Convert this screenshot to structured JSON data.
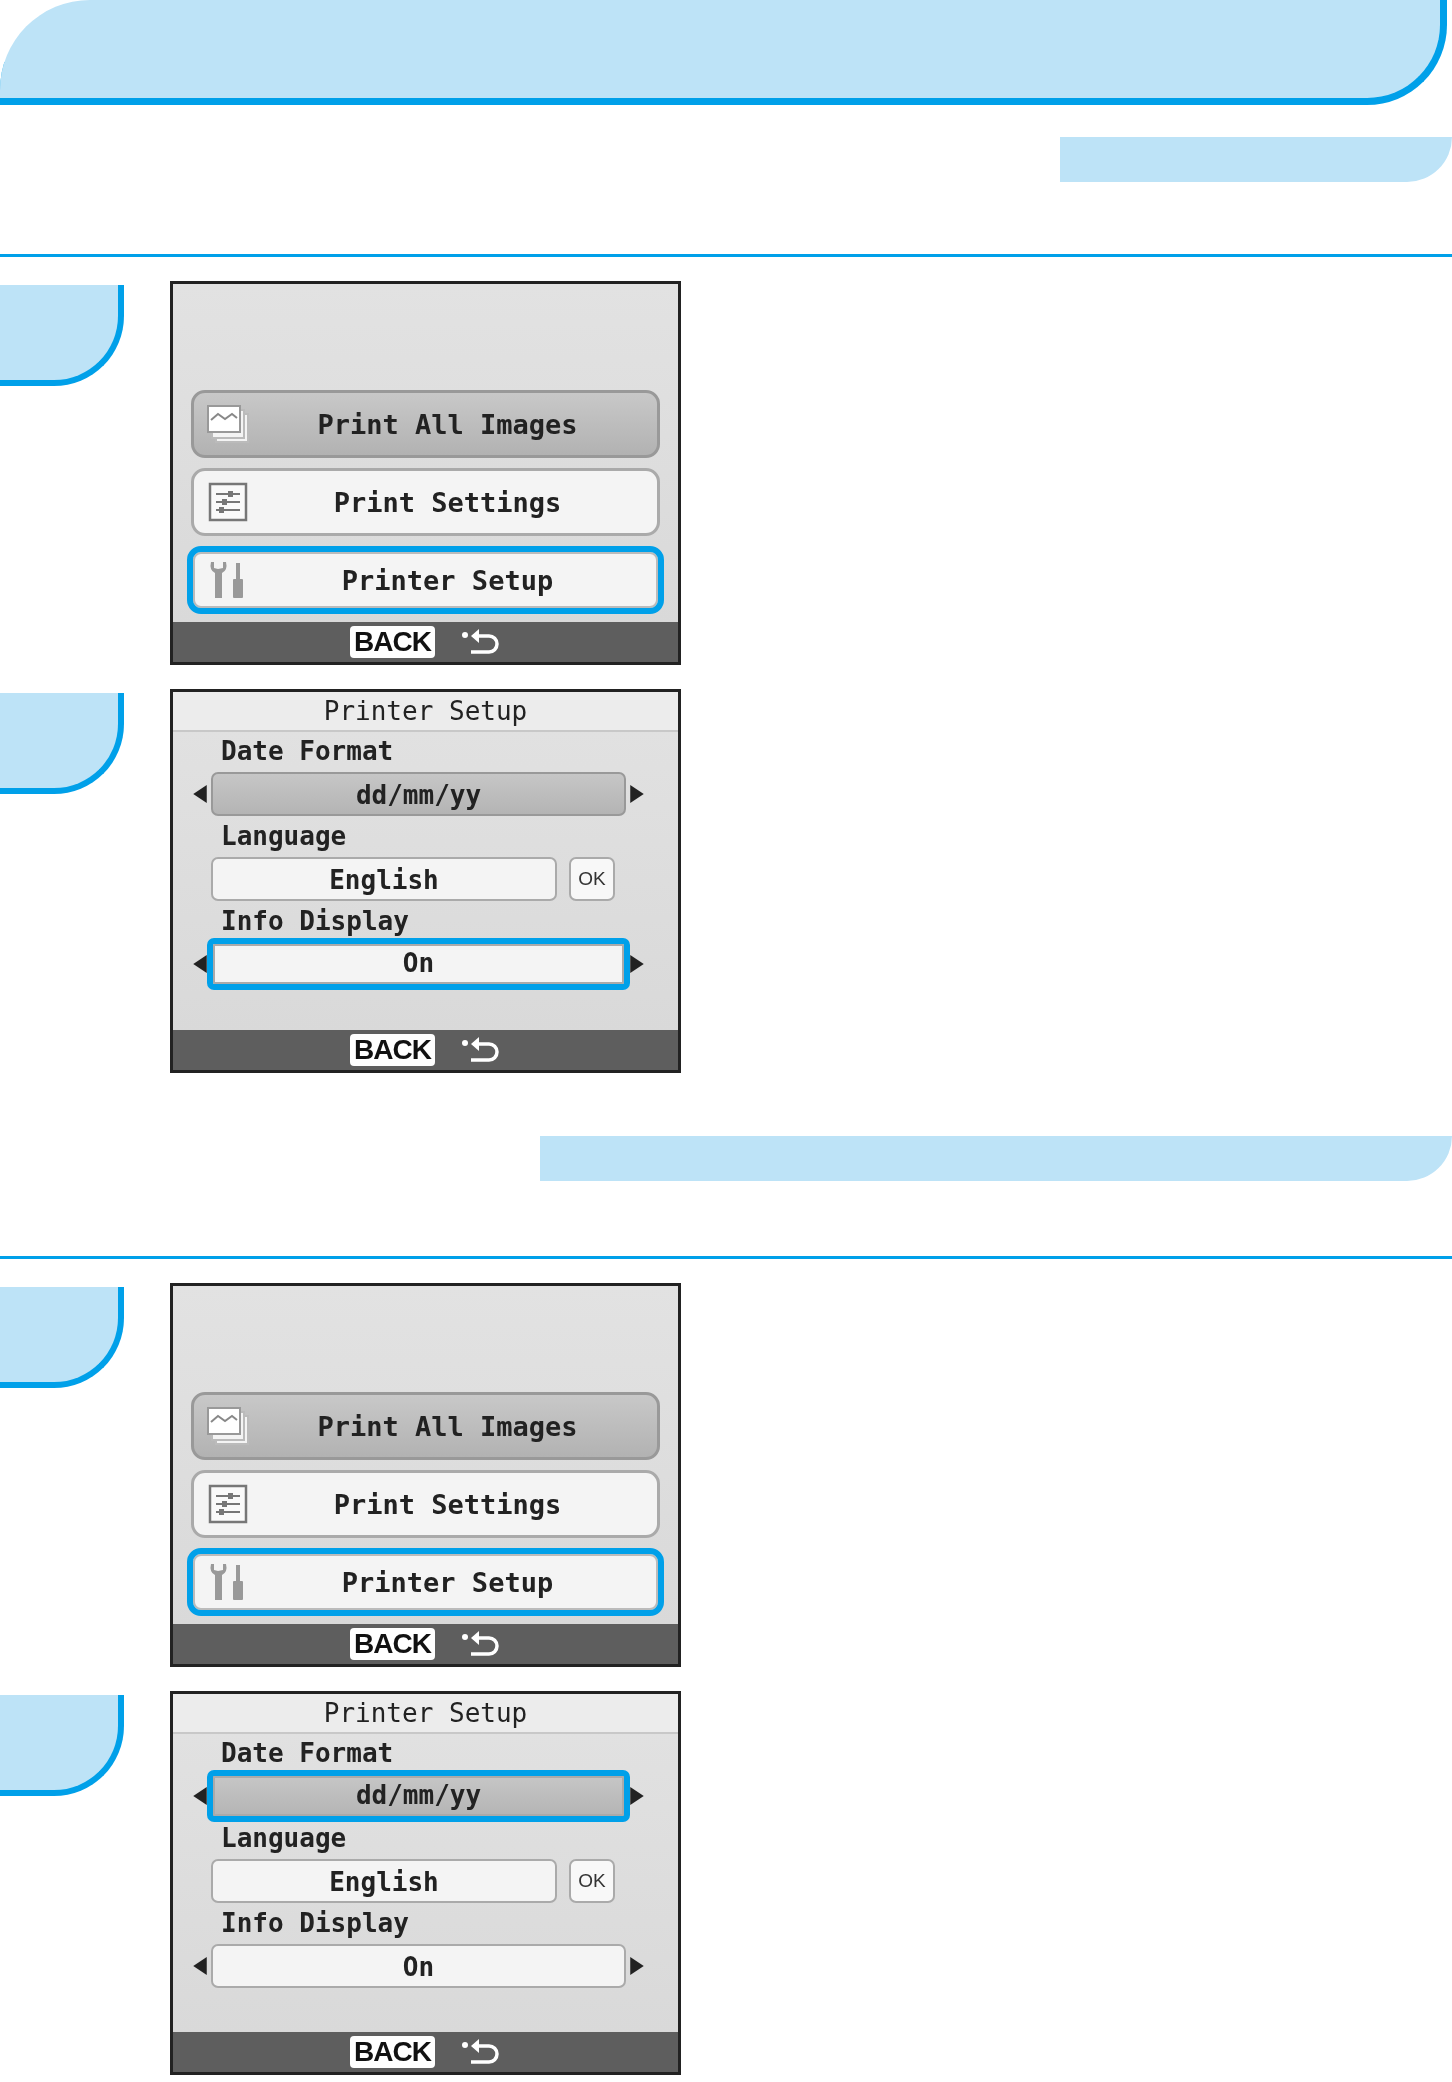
{
  "sections": [
    {
      "steps": [
        {
          "screen": {
            "kind": "menu",
            "items": [
              {
                "label": "Print All Images",
                "shaded": true,
                "selected": false
              },
              {
                "label": "Print Settings",
                "shaded": false,
                "selected": false
              },
              {
                "label": "Printer Setup",
                "shaded": false,
                "selected": true
              }
            ],
            "back": "BACK"
          }
        },
        {
          "screen": {
            "kind": "setup",
            "title": "Printer Setup",
            "rows": [
              {
                "kind": "cycle",
                "label": "Date Format",
                "value": "dd/mm/yy",
                "shaded": true,
                "selected": false
              },
              {
                "kind": "confirm",
                "label": "Language",
                "value": "English",
                "action": "OK",
                "shaded": false,
                "selected": false
              },
              {
                "kind": "cycle",
                "label": "Info Display",
                "value": "On",
                "shaded": false,
                "selected": true
              }
            ],
            "back": "BACK"
          }
        }
      ]
    },
    {
      "steps": [
        {
          "screen": {
            "kind": "menu",
            "items": [
              {
                "label": "Print All Images",
                "shaded": true,
                "selected": false
              },
              {
                "label": "Print Settings",
                "shaded": false,
                "selected": false
              },
              {
                "label": "Printer Setup",
                "shaded": false,
                "selected": true
              }
            ],
            "back": "BACK"
          }
        },
        {
          "screen": {
            "kind": "setup",
            "title": "Printer Setup",
            "rows": [
              {
                "kind": "cycle",
                "label": "Date Format",
                "value": "dd/mm/yy",
                "shaded": true,
                "selected": true
              },
              {
                "kind": "confirm",
                "label": "Language",
                "value": "English",
                "action": "OK",
                "shaded": false,
                "selected": false
              },
              {
                "kind": "cycle",
                "label": "Info Display",
                "value": "On",
                "shaded": false,
                "selected": false
              }
            ],
            "back": "BACK"
          }
        }
      ]
    }
  ]
}
